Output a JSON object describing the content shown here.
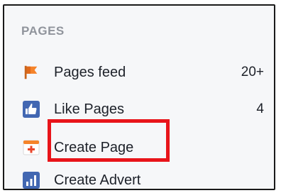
{
  "sidebar": {
    "section_header": "PAGES",
    "items": [
      {
        "label": "Pages feed",
        "count": "20+",
        "icon": "flag-icon"
      },
      {
        "label": "Like Pages",
        "count": "4",
        "icon": "thumbs-up-icon"
      },
      {
        "label": "Create Page",
        "icon": "create-page-icon"
      },
      {
        "label": "Create Advert",
        "icon": "bar-chart-icon"
      }
    ]
  },
  "colors": {
    "highlight": "#e8141a",
    "facebook_blue": "#4267b2",
    "flag_orange": "#f5832a"
  }
}
